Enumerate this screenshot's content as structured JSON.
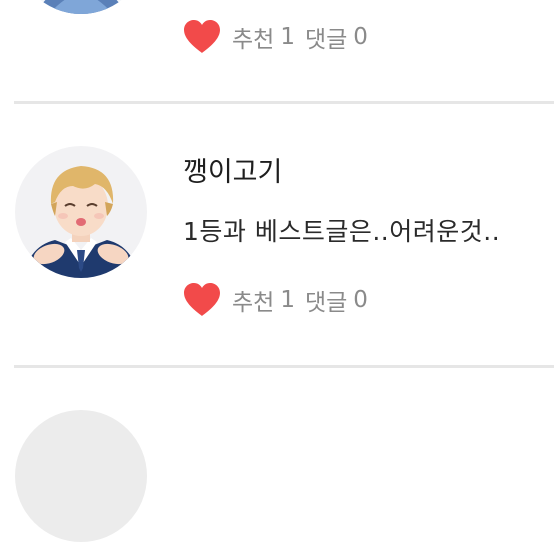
{
  "posts": [
    {
      "recommend_label": "추천",
      "recommend_count": "1",
      "comment_label": "댓글",
      "comment_count": "0"
    },
    {
      "author": "깽이고기",
      "text": "1등과 베스트글은..어려운것..",
      "recommend_label": "추천",
      "recommend_count": "1",
      "comment_label": "댓글",
      "comment_count": "0"
    }
  ],
  "colors": {
    "heart": "#f24a4a",
    "stat_text": "#8a8a8a",
    "divider": "#e6e6e6"
  },
  "icons": {
    "like": "heart-icon"
  }
}
